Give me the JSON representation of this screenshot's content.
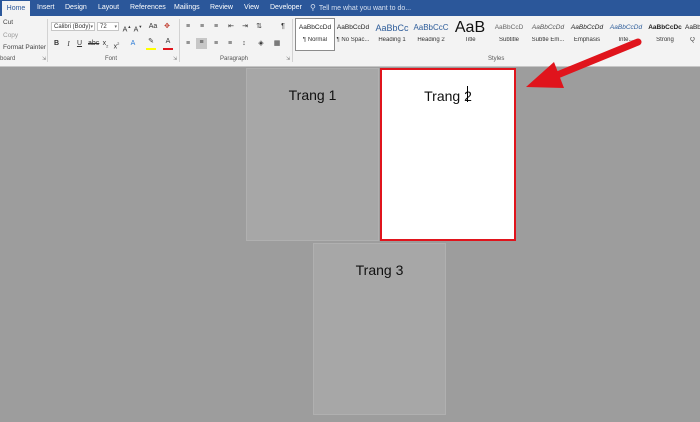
{
  "tabs": [
    "Home",
    "Insert",
    "Design",
    "Layout",
    "References",
    "Mailings",
    "Review",
    "View",
    "Developer"
  ],
  "tell_me": "Tell me what you want to do...",
  "clipboard": {
    "cut": "Cut",
    "copy": "Copy",
    "format_painter": "Format Painter",
    "group_label": "board"
  },
  "font": {
    "name": "Calibri (Body)",
    "size": "72",
    "group_label": "Font",
    "case_button": "Aa"
  },
  "paragraph": {
    "group_label": "Paragraph"
  },
  "styles": {
    "group_label": "Styles",
    "items": [
      {
        "preview": "AaBbCcDd",
        "name": "¶ Normal"
      },
      {
        "preview": "AaBbCcDd",
        "name": "¶ No Spac..."
      },
      {
        "preview": "AaBbCc",
        "name": "Heading 1"
      },
      {
        "preview": "AaBbCcC",
        "name": "Heading 2"
      },
      {
        "preview": "AaB",
        "name": "Title"
      },
      {
        "preview": "AaBbCcD",
        "name": "Subtitle"
      },
      {
        "preview": "AaBbCcDd",
        "name": "Subtle Em..."
      },
      {
        "preview": "AaBbCcDd",
        "name": "Emphasis"
      },
      {
        "preview": "AaBbCcDd",
        "name": "Inte..."
      },
      {
        "preview": "AaBbCcDc",
        "name": "Strong"
      },
      {
        "preview": "AaBb",
        "name": "Q"
      }
    ]
  },
  "pages": [
    "Trang 1",
    "Trang 2",
    "Trang 3"
  ],
  "colors": {
    "accent": "#2b579a",
    "highlight_border": "#e0141c",
    "arrow": "#e0141c"
  }
}
